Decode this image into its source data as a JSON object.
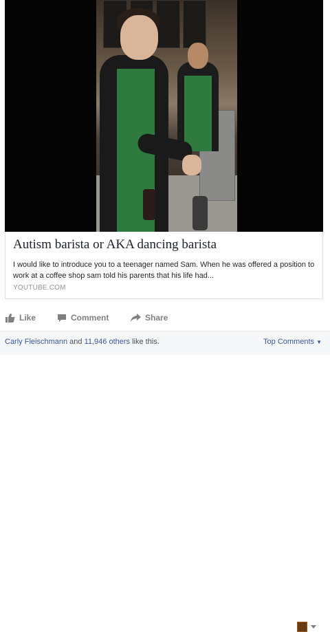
{
  "video": {
    "description_alt": ""
  },
  "link_card": {
    "title": "Autism barista or AKA dancing barista",
    "description": "I would like to introduce you to a teenager named Sam. When he was offered a position to work at a coffee shop sam told his parents that his life had...",
    "domain": "YOUTUBE.COM"
  },
  "actions": {
    "like_label": "Like",
    "comment_label": "Comment",
    "share_label": "Share",
    "icon_color": "#7f7f7f"
  },
  "footer": {
    "liker_name": "Carly Fleischmann",
    "and_text": "and",
    "others_link": "11,946 others",
    "like_suffix": "like this.",
    "top_comments_label": "Top Comments",
    "link_color": "#365899"
  }
}
